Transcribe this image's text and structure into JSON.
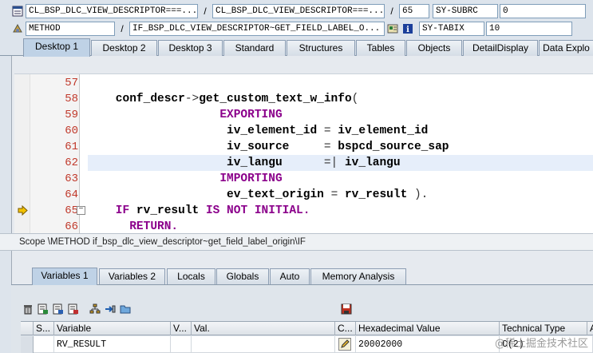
{
  "header": {
    "row1": {
      "program": "CL_BSP_DLC_VIEW_DESCRIPTOR===...",
      "include": "CL_BSP_DLC_VIEW_DESCRIPTOR===...",
      "line": "65",
      "sysvar_name": "SY-SUBRC",
      "sysvar_value": "0"
    },
    "row2": {
      "event_type": "METHOD",
      "event_name": "IF_BSP_DLC_VIEW_DESCRIPTOR~GET_FIELD_LABEL_O...",
      "sysvar_name": "SY-TABIX",
      "sysvar_value": "10"
    },
    "separator": "/"
  },
  "desktop_tabs": [
    {
      "label": "Desktop 1",
      "active": true
    },
    {
      "label": "Desktop 2",
      "active": false
    },
    {
      "label": "Desktop 3",
      "active": false
    },
    {
      "label": "Standard",
      "active": false
    },
    {
      "label": "Structures",
      "active": false
    },
    {
      "label": "Tables",
      "active": false
    },
    {
      "label": "Objects",
      "active": false
    },
    {
      "label": "DetailDisplay",
      "active": false
    },
    {
      "label": "Data Explo",
      "active": false
    }
  ],
  "code": {
    "lines": [
      {
        "num": "57",
        "parts": []
      },
      {
        "num": "58",
        "parts": [
          {
            "t": "    conf_descr",
            "c": ""
          },
          {
            "t": "->",
            "c": "op"
          },
          {
            "t": "get_custom_text_w_info",
            "c": ""
          },
          {
            "t": "(",
            "c": "op"
          }
        ]
      },
      {
        "num": "59",
        "parts": [
          {
            "t": "                   EXPORTING",
            "c": "kw"
          }
        ]
      },
      {
        "num": "60",
        "parts": [
          {
            "t": "                    iv_element_id ",
            "c": ""
          },
          {
            "t": "=",
            "c": "op"
          },
          {
            "t": " iv_element_id",
            "c": ""
          }
        ]
      },
      {
        "num": "61",
        "parts": [
          {
            "t": "                    iv_source     ",
            "c": ""
          },
          {
            "t": "=",
            "c": "op"
          },
          {
            "t": " bspcd_source_sap",
            "c": ""
          }
        ]
      },
      {
        "num": "62",
        "parts": [
          {
            "t": "                    iv_langu      ",
            "c": ""
          },
          {
            "t": "=|",
            "c": "op"
          },
          {
            "t": " iv_langu",
            "c": ""
          }
        ]
      },
      {
        "num": "63",
        "parts": [
          {
            "t": "                   IMPORTING",
            "c": "kw"
          }
        ]
      },
      {
        "num": "64",
        "parts": [
          {
            "t": "                    ev_text_origin ",
            "c": ""
          },
          {
            "t": "=",
            "c": "op"
          },
          {
            "t": " rv_result ",
            "c": ""
          },
          {
            "t": ").",
            "c": "op"
          }
        ]
      },
      {
        "num": "65",
        "parts": [
          {
            "t": "    IF",
            "c": "kw"
          },
          {
            "t": " rv_result ",
            "c": ""
          },
          {
            "t": "IS NOT INITIAL.",
            "c": "kw"
          }
        ]
      },
      {
        "num": "66",
        "parts": [
          {
            "t": "      RETURN.",
            "c": "kw"
          }
        ]
      }
    ]
  },
  "scope": "Scope \\METHOD if_bsp_dlc_view_descriptor~get_field_label_origin\\IF",
  "var_tabs": [
    {
      "label": "Variables 1",
      "active": true
    },
    {
      "label": "Variables 2",
      "active": false
    },
    {
      "label": "Locals",
      "active": false
    },
    {
      "label": "Globals",
      "active": false
    },
    {
      "label": "Auto",
      "active": false
    },
    {
      "label": "Memory Analysis",
      "active": false
    }
  ],
  "grid": {
    "columns": [
      "S...",
      "Variable",
      "V...",
      "Val.",
      "C...",
      "Hexadecimal Value",
      "Technical Type",
      "A"
    ],
    "row": {
      "variable": "RV_RESULT",
      "hex": "20002000",
      "type": "C(2)"
    }
  },
  "watermark": "@稀土掘金技术社区"
}
